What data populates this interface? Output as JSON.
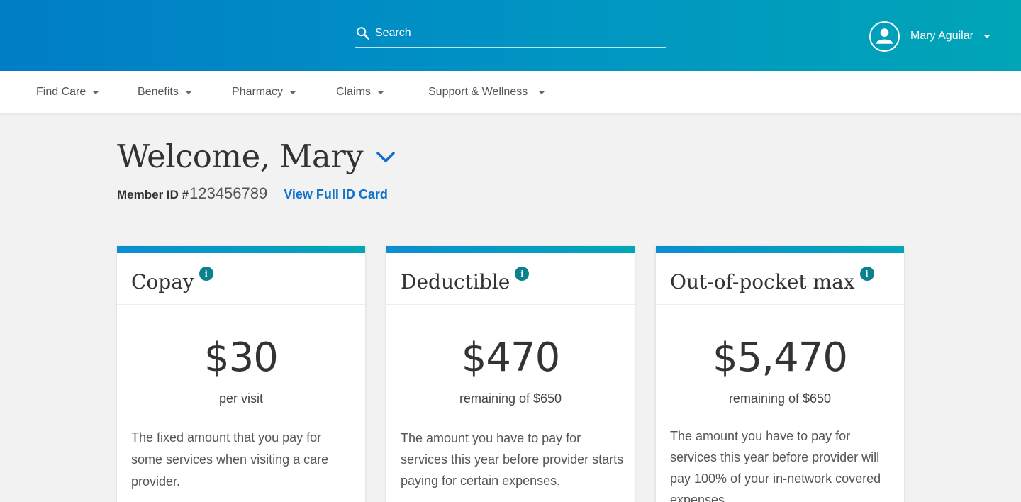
{
  "header": {
    "search": {
      "placeholder": "Search"
    },
    "user": {
      "name": "Mary Aguilar"
    }
  },
  "nav": {
    "items": [
      {
        "label": "Find Care"
      },
      {
        "label": "Benefits"
      },
      {
        "label": "Pharmacy"
      },
      {
        "label": "Claims"
      },
      {
        "label": "Support & Wellness"
      }
    ]
  },
  "welcome": {
    "title": "Welcome, Mary",
    "member_label": "Member ID #",
    "member_id": "123456789",
    "id_card_link": "View Full ID Card"
  },
  "cards": [
    {
      "title": "Copay",
      "amount": "$30",
      "sub": "per visit",
      "description": "The fixed amount that you pay for some services when visiting a care provider."
    },
    {
      "title": "Deductible",
      "amount": "$470",
      "sub": "remaining of $650",
      "description": "The amount you have to pay for services this year before provider starts paying for certain expenses."
    },
    {
      "title": "Out-of-pocket max",
      "amount": "$5,470",
      "sub": "remaining of $650",
      "description": "The amount you have to pay for services this year before provider will pay 100% of your in-network covered expenses."
    }
  ],
  "icons": {
    "search": "search-icon",
    "avatar": "user-avatar-icon",
    "caret": "caret-down-icon",
    "chevron": "chevron-down-icon",
    "info": "info-icon"
  },
  "colors": {
    "header_gradient_start": "#007dc6",
    "header_gradient_end": "#00a5b6",
    "link": "#1170c9",
    "info_badge": "#0b8190",
    "background": "#f2f2f2"
  }
}
